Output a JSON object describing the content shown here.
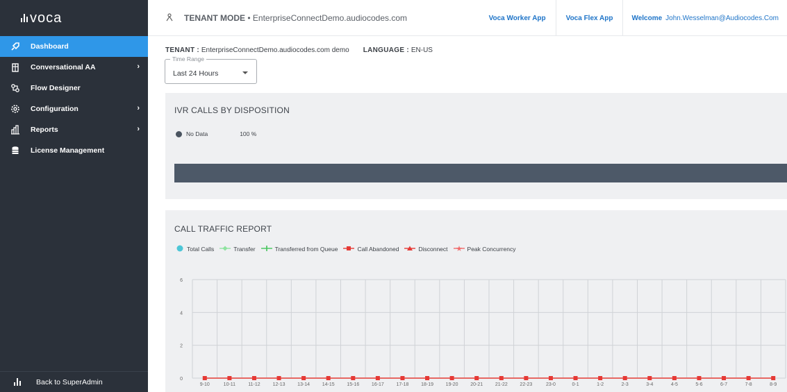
{
  "app": {
    "logo": "voca"
  },
  "sidebar": {
    "items": [
      {
        "label": "Dashboard",
        "icon": "rocket-icon",
        "active": true,
        "has_chevron": false
      },
      {
        "label": "Conversational AA",
        "icon": "building-icon",
        "active": false,
        "has_chevron": true
      },
      {
        "label": "Flow Designer",
        "icon": "flow-icon",
        "active": false,
        "has_chevron": false
      },
      {
        "label": "Configuration",
        "icon": "gear-icon",
        "active": false,
        "has_chevron": true
      },
      {
        "label": "Reports",
        "icon": "bar-chart-icon",
        "active": false,
        "has_chevron": true
      },
      {
        "label": "License Management",
        "icon": "database-icon",
        "active": false,
        "has_chevron": false
      }
    ],
    "back_label": "Back to SuperAdmin"
  },
  "header": {
    "mode_label": "TENANT MODE",
    "mode_separator": "•",
    "mode_domain": "EnterpriseConnectDemo.audiocodes.com",
    "links": [
      "Voca Worker App",
      "Voca Flex App"
    ],
    "welcome_label": "Welcome",
    "user": "John.Wesselman@Audiocodes.Com"
  },
  "info": {
    "tenant_label": "TENANT :",
    "tenant_value": "EnterpriseConnectDemo.audiocodes.com demo",
    "language_label": "LANGUAGE :",
    "language_value": "EN-US"
  },
  "time_range": {
    "legend": "Time Range",
    "value": "Last 24 Hours"
  },
  "ivr_panel": {
    "title": "IVR CALLS BY DISPOSITION",
    "legend_label": "No Data",
    "legend_value": "100 %"
  },
  "traffic_panel": {
    "title": "CALL TRAFFIC REPORT"
  },
  "colors": {
    "accent": "#2f97e8",
    "sidebar": "#2b313a",
    "link": "#1e74c8",
    "abandoned": "#e53935"
  },
  "chart_data": {
    "type": "line",
    "categories": [
      "9-10",
      "10-11",
      "11-12",
      "12-13",
      "13-14",
      "14-15",
      "15-16",
      "16-17",
      "17-18",
      "18-19",
      "19-20",
      "20-21",
      "21-22",
      "22-23",
      "23-0",
      "0-1",
      "1-2",
      "2-3",
      "3-4",
      "4-5",
      "5-6",
      "6-7",
      "7-8",
      "8-9"
    ],
    "series": [
      {
        "name": "Total Calls",
        "color": "#4dc6d6",
        "marker": "circle",
        "values": [
          0,
          0,
          0,
          0,
          0,
          0,
          0,
          0,
          0,
          0,
          0,
          0,
          0,
          0,
          0,
          0,
          0,
          0,
          0,
          0,
          0,
          0,
          0,
          0
        ]
      },
      {
        "name": "Transfer",
        "color": "#8fe3a0",
        "marker": "diamond",
        "values": [
          0,
          0,
          0,
          0,
          0,
          0,
          0,
          0,
          0,
          0,
          0,
          0,
          0,
          0,
          0,
          0,
          0,
          0,
          0,
          0,
          0,
          0,
          0,
          0
        ]
      },
      {
        "name": "Transferred from Queue",
        "color": "#43c45a",
        "marker": "cross",
        "values": [
          0,
          0,
          0,
          0,
          0,
          0,
          0,
          0,
          0,
          0,
          0,
          0,
          0,
          0,
          0,
          0,
          0,
          0,
          0,
          0,
          0,
          0,
          0,
          0
        ]
      },
      {
        "name": "Call Abandoned",
        "color": "#e53935",
        "marker": "square",
        "values": [
          0,
          0,
          0,
          0,
          0,
          0,
          0,
          0,
          0,
          0,
          0,
          0,
          0,
          0,
          0,
          0,
          0,
          0,
          0,
          0,
          0,
          0,
          0,
          0
        ]
      },
      {
        "name": "Disconnect",
        "color": "#e53935",
        "marker": "triangle",
        "values": [
          0,
          0,
          0,
          0,
          0,
          0,
          0,
          0,
          0,
          0,
          0,
          0,
          0,
          0,
          0,
          0,
          0,
          0,
          0,
          0,
          0,
          0,
          0,
          0
        ]
      },
      {
        "name": "Peak Concurrency",
        "color": "#f06a6a",
        "marker": "star",
        "values": [
          0,
          0,
          0,
          0,
          0,
          0,
          0,
          0,
          0,
          0,
          0,
          0,
          0,
          0,
          0,
          0,
          0,
          0,
          0,
          0,
          0,
          0,
          0,
          0
        ]
      }
    ],
    "title": "CALL TRAFFIC REPORT",
    "xlabel": "",
    "ylabel": "",
    "ylim": [
      0,
      6
    ],
    "yticks": [
      0,
      2,
      4,
      6
    ],
    "grid": true,
    "legend": "top-left"
  }
}
